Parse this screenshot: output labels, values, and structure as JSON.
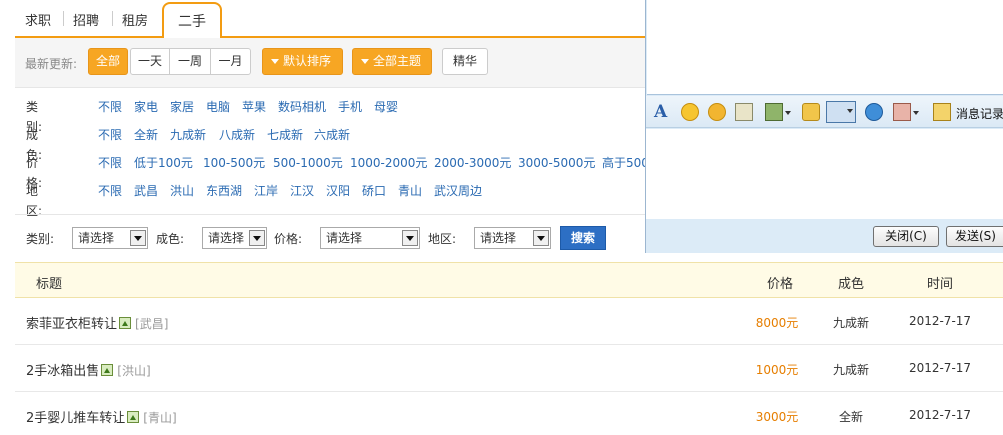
{
  "tabs": [
    {
      "label": "求职"
    },
    {
      "label": "招聘"
    },
    {
      "label": "租房"
    },
    {
      "label": "二手",
      "active": true
    }
  ],
  "toolbar": {
    "latest_label": "最新更新:",
    "periods": [
      "全部",
      "一天",
      "一周",
      "一月"
    ],
    "sort_label": "默认排序",
    "topic_label": "全部主题",
    "featured_label": "精华"
  },
  "filters": {
    "category": {
      "label": "类别:",
      "options": [
        "不限",
        "家电",
        "家居",
        "电脑",
        "苹果",
        "数码相机",
        "手机",
        "母婴"
      ]
    },
    "condition": {
      "label": "成色:",
      "options": [
        "不限",
        "全新",
        "九成新",
        "八成新",
        "七成新",
        "六成新"
      ]
    },
    "price": {
      "label": "价格:",
      "options": [
        "不限",
        "低于100元",
        "100-500元",
        "500-1000元",
        "1000-2000元",
        "2000-3000元",
        "3000-5000元",
        "高于500"
      ]
    },
    "district": {
      "label": "地区:",
      "options": [
        "不限",
        "武昌",
        "洪山",
        "东西湖",
        "江岸",
        "江汉",
        "汉阳",
        "硚口",
        "青山",
        "武汉周边"
      ]
    }
  },
  "search": {
    "category_label": "类别:",
    "condition_label": "成色:",
    "price_label": "价格:",
    "district_label": "地区:",
    "select_placeholder": "请选择",
    "button_label": "搜索"
  },
  "table": {
    "headers": {
      "title": "标题",
      "price": "价格",
      "condition": "成色",
      "time": "时间"
    },
    "rows": [
      {
        "title": "索菲亚衣柜转让",
        "area": "[武昌]",
        "price": "8000元",
        "condition": "九成新",
        "time": "2012-7-17"
      },
      {
        "title": "2手冰箱出售",
        "area": "[洪山]",
        "price": "1000元",
        "condition": "九成新",
        "time": "2012-7-17"
      },
      {
        "title": "2手婴儿推车转让",
        "area": "[青山]",
        "price": "3000元",
        "condition": "全新",
        "time": "2012-7-17"
      }
    ]
  },
  "chat": {
    "toolbar_icons": [
      "font-icon",
      "emoticon-icon",
      "magic-face-icon",
      "screenshot-icon",
      "image-icon",
      "transfer-icon",
      "video-icon",
      "music-icon",
      "more-icon"
    ],
    "message_record_label": "消息记录",
    "close_label": "关闭(C)",
    "send_label": "发送(S)"
  },
  "colors": {
    "accent": "#f39c12",
    "link": "#2a6ab2",
    "price": "#e67e00",
    "search_button": "#2d6fc4"
  }
}
